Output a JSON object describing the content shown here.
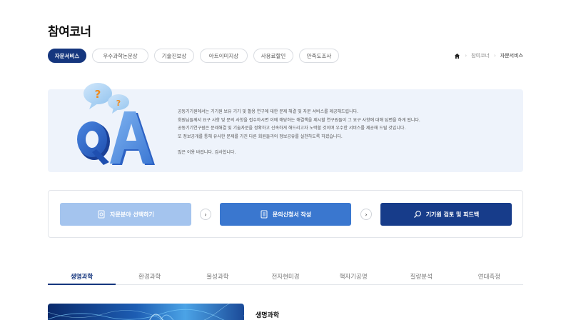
{
  "page": {
    "title": "참여코너"
  },
  "pills": [
    {
      "label": "자문서비스",
      "active": true
    },
    {
      "label": "우수과학논문상",
      "active": false
    },
    {
      "label": "기술진보상",
      "active": false
    },
    {
      "label": "아트이미지상",
      "active": false
    },
    {
      "label": "사용료할인",
      "active": false
    },
    {
      "label": "만족도조사",
      "active": false
    }
  ],
  "breadcrumb": {
    "home_icon": "home-icon",
    "level1": "참여코너",
    "current": "자문서비스",
    "separator": "›"
  },
  "intro": {
    "art_marks": [
      "?",
      "?"
    ],
    "lines": [
      "공동기기원에서는 기기원 보유 기기 및 활용 연구에 대한 문제 해결 및 자문 서비스를 제공해드립니다.",
      "회원님들께서 요구 사항 및 문의 사항을 접수하시면 이에 해당하는 해결책을 제시할 연구원들이 그 요구 사항에 대해 답변을 하게 됩니다.",
      "공동기기연구원은 문제해결 및 기술자문을 정확하고 신속하게 해드리고자 노력할 것이며 우수한 서비스를 제공해 드릴 것입니다.",
      "또 정보공개를 통해 유사한 문제를 가진 다른 회원들과의 정보공유를 실천하도록 하겠습니다."
    ],
    "closing": "많은 이용 바랍니다. 감사합니다."
  },
  "steps": [
    {
      "label": "자문분야 선택하기",
      "icon": "document-icon",
      "color": "#a4c4ee"
    },
    {
      "label": "문의신청서 작성",
      "icon": "form-icon",
      "color": "#3a77cf"
    },
    {
      "label": "기기원 검토 및 피드백",
      "icon": "magnifier-icon",
      "color": "#173c8a"
    }
  ],
  "arrow_glyph": "›",
  "tabs": [
    {
      "label": "생명과학",
      "active": true
    },
    {
      "label": "환경과학",
      "active": false
    },
    {
      "label": "물성과학",
      "active": false
    },
    {
      "label": "전자현미경",
      "active": false
    },
    {
      "label": "핵자기공명",
      "active": false
    },
    {
      "label": "질량분석",
      "active": false
    },
    {
      "label": "연대측정",
      "active": false
    }
  ],
  "section": {
    "title": "생명과학"
  },
  "colors": {
    "primary": "#15367e",
    "accent": "#3a77cf",
    "light": "#a4c4ee",
    "intro_bg": "#eef3fb"
  }
}
